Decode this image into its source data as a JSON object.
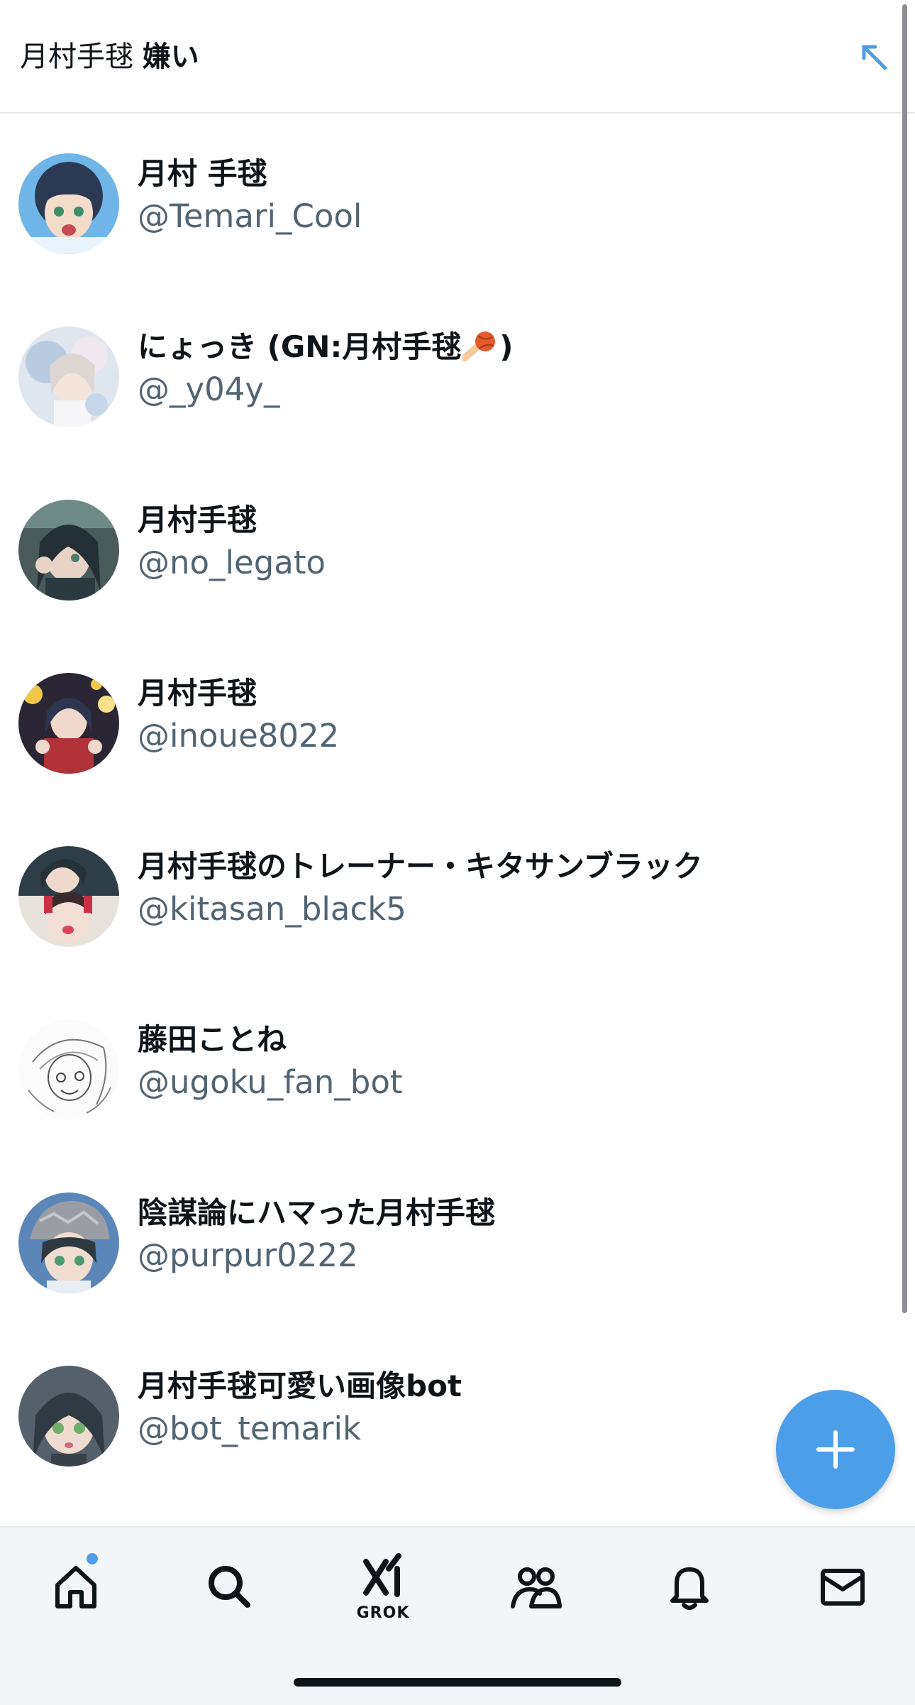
{
  "search": {
    "query_prefix": "月村手毬 ",
    "query_bold": "嫌い"
  },
  "results": [
    {
      "name": "月村 手毬",
      "handle": "@Temari_Cool",
      "avatar": "anime-avatar"
    },
    {
      "name_before_emoji": "にょっき (GN:月村手毬",
      "emoji": "meteor-ball-emoji",
      "name_after_emoji": ")",
      "handle": "@_y04y_",
      "avatar": "anime-avatar"
    },
    {
      "name": "月村手毬",
      "handle": "@no_legato",
      "avatar": "anime-avatar"
    },
    {
      "name": "月村手毬",
      "handle": "@inoue8022",
      "avatar": "anime-avatar"
    },
    {
      "name": "月村手毬のトレーナー・キタサンブラック",
      "handle": "@kitasan_black5",
      "avatar": "anime-avatar"
    },
    {
      "name": "藤田ことね",
      "handle": "@ugoku_fan_bot",
      "avatar": "sketch-avatar"
    },
    {
      "name": "陰謀論にハマった月村手毬",
      "handle": "@purpur0222",
      "avatar": "anime-avatar"
    },
    {
      "name": "月村手毬可愛い画像bot",
      "handle": "@bot_temarik",
      "avatar": "anime-avatar"
    }
  ],
  "fab": {
    "icon": "plus-icon"
  },
  "tabbar": {
    "tabs": [
      {
        "icon": "home-icon",
        "has_badge": true
      },
      {
        "icon": "search-icon"
      },
      {
        "icon": "grok-icon",
        "label": "GROK"
      },
      {
        "icon": "communities-icon"
      },
      {
        "icon": "bell-icon"
      },
      {
        "icon": "mail-icon"
      }
    ]
  },
  "colors": {
    "accent": "#4c9ee8",
    "text_primary": "#0f1419",
    "text_secondary": "#536471"
  }
}
